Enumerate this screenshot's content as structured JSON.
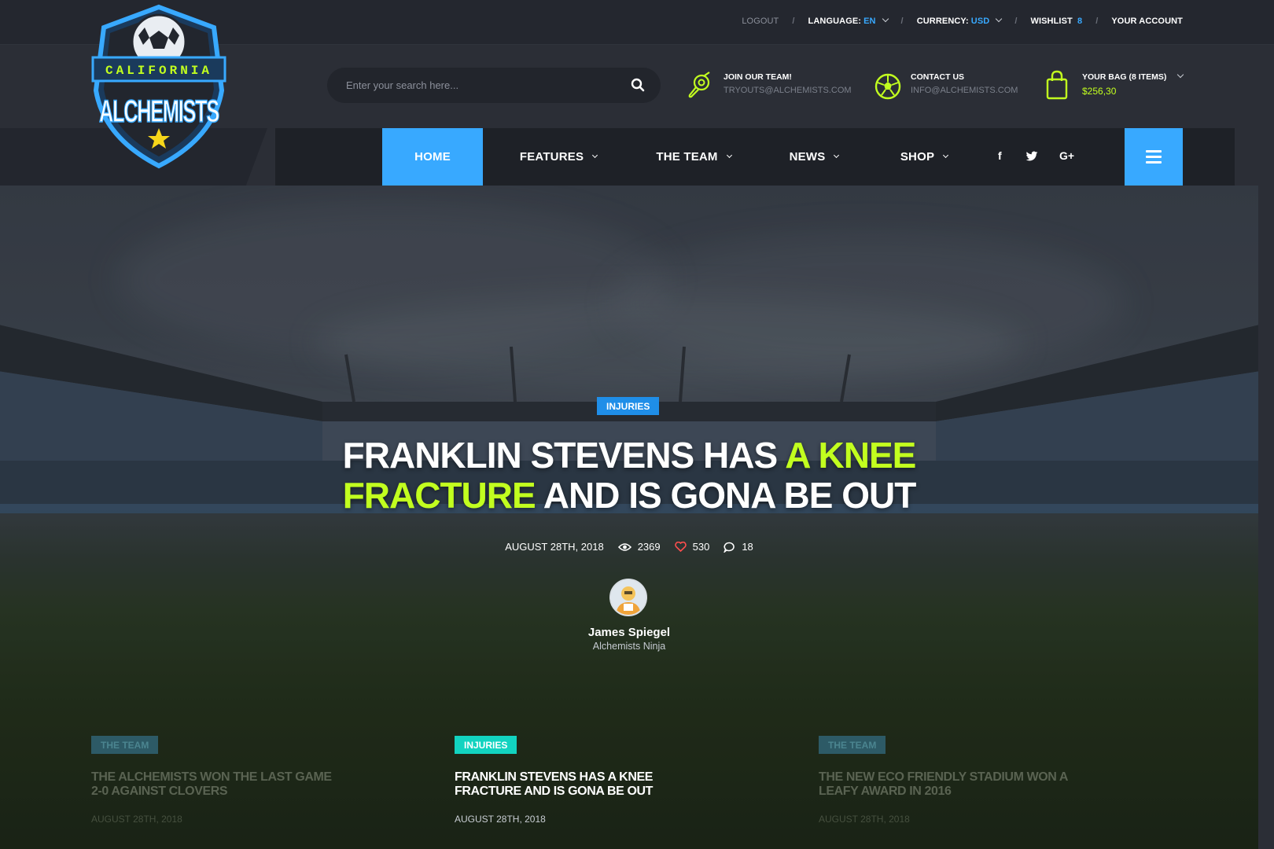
{
  "topbar": {
    "logout": "LOGOUT",
    "language_label": "LANGUAGE:",
    "language_value": "EN",
    "currency_label": "CURRENCY:",
    "currency_value": "USD",
    "wishlist_label": "WISHLIST",
    "wishlist_count": "8",
    "account": "YOUR ACCOUNT",
    "separator": "/"
  },
  "logo": {
    "top_text": "CALIFORNIA",
    "main_text": "ALCHEMISTS"
  },
  "search": {
    "placeholder": "Enter your search here..."
  },
  "header_info": {
    "join": {
      "title": "JOIN OUR TEAM!",
      "subtitle": "TRYOUTS@ALCHEMISTS.COM",
      "icon": "whistle-icon"
    },
    "contact": {
      "title": "CONTACT US",
      "subtitle": "INFO@ALCHEMISTS.COM",
      "icon": "soccer-ball-icon"
    },
    "bag": {
      "title": "YOUR BAG (8 ITEMS)",
      "subtitle": "$256,30",
      "icon": "shopping-bag-icon"
    }
  },
  "nav": {
    "items": [
      {
        "label": "HOME",
        "active": true
      },
      {
        "label": "FEATURES",
        "active": false
      },
      {
        "label": "THE TEAM",
        "active": false
      },
      {
        "label": "NEWS",
        "active": false
      },
      {
        "label": "SHOP",
        "active": false
      }
    ],
    "social": [
      "f",
      "twitter-icon",
      "G+"
    ]
  },
  "hero": {
    "category": "INJURIES",
    "title_line1_a": "FRANKLIN STEVENS HAS ",
    "title_line1_b": "A KNEE",
    "title_line2_a": "FRACTURE",
    "title_line2_b": " AND IS GONA BE OUT",
    "date": "AUGUST 28TH, 2018",
    "views": "2369",
    "likes": "530",
    "comments": "18",
    "author_name": "James Spiegel",
    "author_role": "Alchemists Ninja"
  },
  "cards": [
    {
      "category": "THE TEAM",
      "title": "THE ALCHEMISTS WON THE LAST GAME 2-0 AGAINST CLOVERS",
      "date": "AUGUST 28TH, 2018"
    },
    {
      "category": "INJURIES",
      "title": "FRANKLIN STEVENS HAS A KNEE FRACTURE AND IS GONA BE OUT",
      "date": "AUGUST 28TH, 2018"
    },
    {
      "category": "THE TEAM",
      "title": "THE NEW ECO FRIENDLY STADIUM WON A LEAFY AWARD IN 2016",
      "date": "AUGUST 28TH, 2018"
    }
  ],
  "colors": {
    "accent_blue": "#38a9ff",
    "accent_green": "#c2ff1f",
    "teal": "#12d3c0"
  }
}
